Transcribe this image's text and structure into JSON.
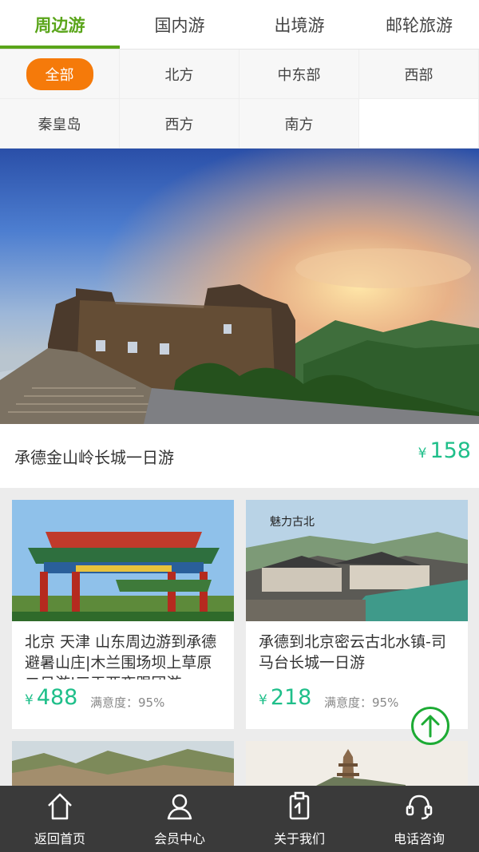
{
  "tabs": [
    {
      "label": "周边游",
      "active": true
    },
    {
      "label": "国内游",
      "active": false
    },
    {
      "label": "出境游",
      "active": false
    },
    {
      "label": "邮轮旅游",
      "active": false
    }
  ],
  "regions": [
    {
      "label": "全部",
      "active": true
    },
    {
      "label": "北方"
    },
    {
      "label": "中东部"
    },
    {
      "label": "西部"
    },
    {
      "label": "秦皇岛"
    },
    {
      "label": "西方"
    },
    {
      "label": "南方"
    }
  ],
  "featured": {
    "title": "承德金山岭长城一日游",
    "currency": "¥",
    "price": "158"
  },
  "products": [
    {
      "title": "北京 天津 山东周边游到承德避暑山庄|木兰围场坝上草原二日游|三天两夜跟团游",
      "currency": "¥",
      "price": "488",
      "satisfaction": "满意度：95%"
    },
    {
      "title": "承德到北京密云古北水镇-司马台长城一日游",
      "currency": "¥",
      "price": "218",
      "satisfaction": "满意度：95%"
    }
  ],
  "bottom_nav": [
    {
      "label": "返回首页",
      "icon": "home-icon"
    },
    {
      "label": "会员中心",
      "icon": "user-icon"
    },
    {
      "label": "关于我们",
      "icon": "info-icon"
    },
    {
      "label": "电话咨询",
      "icon": "headset-icon"
    }
  ],
  "colors": {
    "accent_green": "#5aa51a",
    "price_green": "#1fbf8a",
    "active_orange": "#f57a0a",
    "nav_bg": "#3a3a3a"
  }
}
